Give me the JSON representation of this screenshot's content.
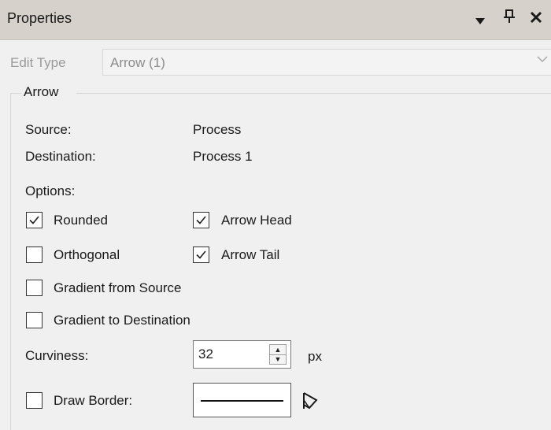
{
  "panel": {
    "title": "Properties",
    "icons": [
      "dropdown-arrow-icon",
      "pin-icon",
      "close-icon"
    ]
  },
  "edit_type": {
    "label": "Edit Type",
    "value": "Arrow (1)"
  },
  "group": {
    "title": "Arrow",
    "source_label": "Source:",
    "source_value": "Process",
    "destination_label": "Destination:",
    "destination_value": "Process 1",
    "options_label": "Options:"
  },
  "options": {
    "rounded": {
      "label": "Rounded",
      "checked": true
    },
    "arrow_head": {
      "label": "Arrow Head",
      "checked": true
    },
    "orthogonal": {
      "label": "Orthogonal",
      "checked": false
    },
    "arrow_tail": {
      "label": "Arrow Tail",
      "checked": true
    },
    "gradient_from_source": {
      "label": "Gradient from Source",
      "checked": false
    },
    "gradient_to_destination": {
      "label": "Gradient to Destination",
      "checked": false
    }
  },
  "curviness": {
    "label": "Curviness:",
    "value": "32",
    "unit": "px"
  },
  "draw_border": {
    "label": "Draw Border:",
    "checked": false
  }
}
